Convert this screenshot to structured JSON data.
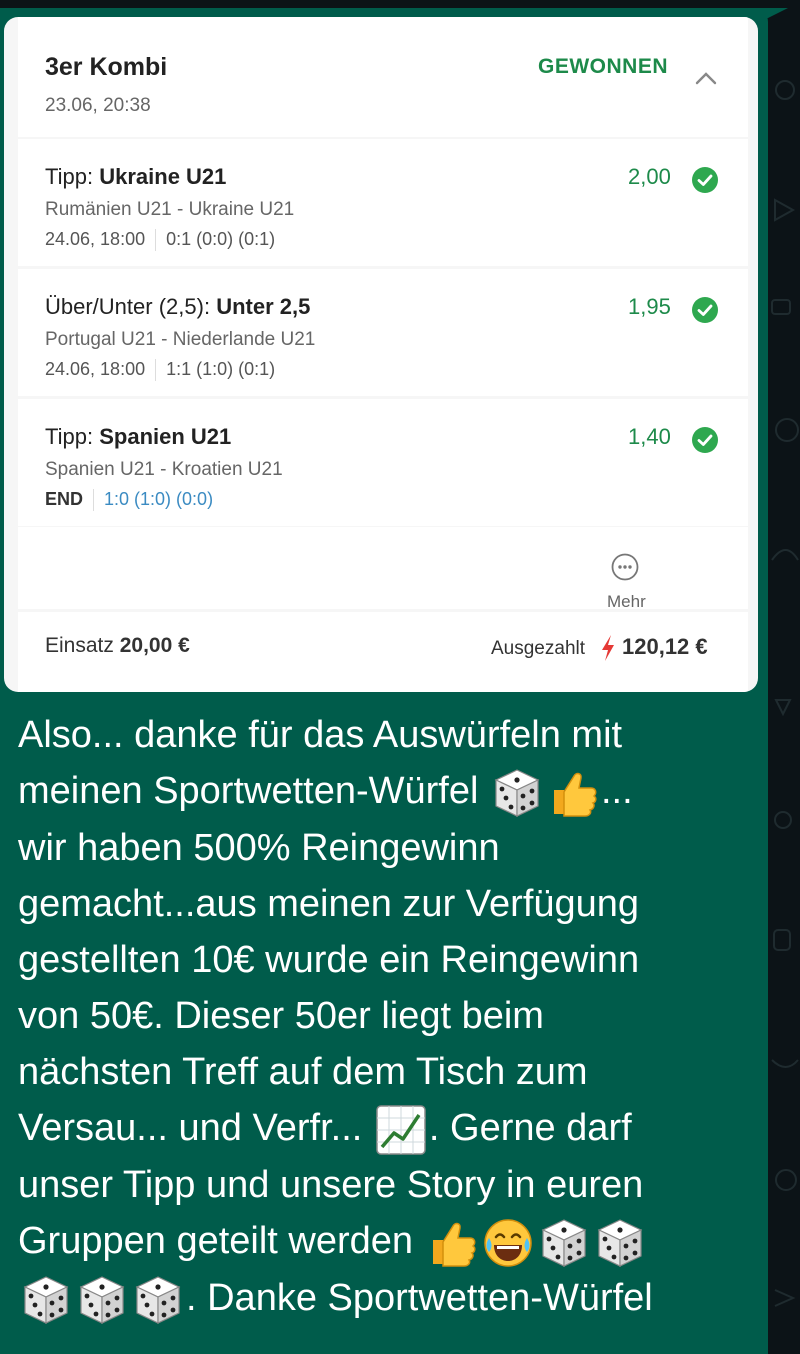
{
  "bet": {
    "title": "3er Kombi",
    "date": "23.06, 20:38",
    "status": "GEWONNEN",
    "selections": [
      {
        "tipp_prefix": "Tipp:",
        "tipp_pick": "Ukraine U21",
        "match": "Rumänien U21 - Ukraine U21",
        "meta_left": "24.06, 18:00",
        "meta_right": "0:1 (0:0) (0:1)",
        "odds": "2,00"
      },
      {
        "tipp_prefix": "Über/Unter (2,5):",
        "tipp_pick": "Unter 2,5",
        "match": "Portugal U21 - Niederlande U21",
        "meta_left": "24.06, 18:00",
        "meta_right": "1:1 (1:0) (0:1)",
        "odds": "1,95"
      },
      {
        "tipp_prefix": "Tipp:",
        "tipp_pick": "Spanien U21",
        "match": "Spanien U21 - Kroatien U21",
        "meta_left": "END",
        "meta_right": "1:0 (1:0) (0:0)",
        "odds": "1,40"
      }
    ],
    "more_label": "Mehr",
    "stake_label": "Einsatz",
    "stake_value": "20,00 €",
    "payout_label": "Ausgezahlt",
    "payout_value": "120,12 €",
    "colors": {
      "win": "#1d8a4a",
      "live_score": "#3b8bc2",
      "bolt": "#e53935",
      "bubble": "#005c4b"
    }
  },
  "message": {
    "lines": [
      "Also... danke für das Auswürfeln mit",
      "meinen Sportwetten-Würfel",
      "...",
      "wir haben 500% Reingewinn",
      "gemacht...aus meinen zur Verfügung",
      "gestellten 10€ wurde ein Reingewinn",
      "von 50€. Dieser 50er liegt beim",
      "nächsten Treff auf dem Tisch zum",
      "Versau... und Verfr...",
      ". Gerne darf",
      "unser Tipp und unsere Story in euren",
      "Gruppen geteilt werden",
      ". Danke Sportwetten-Würfel"
    ],
    "emojis": [
      "dice-emoji",
      "thumbs-up-emoji",
      "chart-increasing-emoji",
      "laughing-emoji"
    ]
  }
}
